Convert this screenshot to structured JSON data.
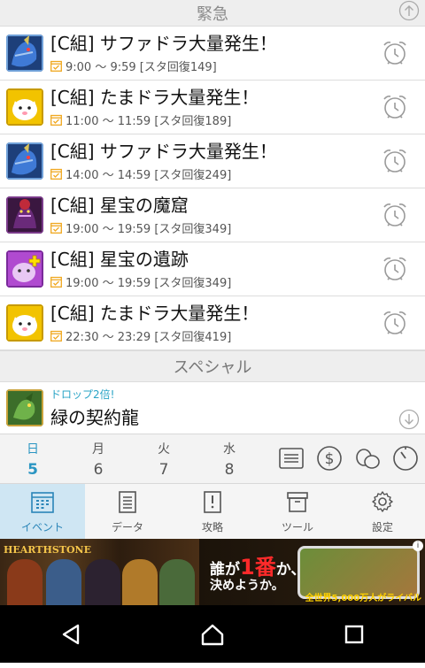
{
  "urgent_header": "緊急",
  "events": [
    {
      "title": "[C組] サファドラ大量発生！",
      "time": "9:00 ～ 9:59 [スタ回復149]",
      "monster": "blue-dragon"
    },
    {
      "title": "[C組] たまドラ大量発生！",
      "time": "11:00 ～ 11:59 [スタ回復189]",
      "monster": "tamadra"
    },
    {
      "title": "[C組] サファドラ大量発生！",
      "time": "14:00 ～ 14:59 [スタ回復249]",
      "monster": "blue-dragon"
    },
    {
      "title": "[C組] 星宝の魔窟",
      "time": "19:00 ～ 19:59 [スタ回復349]",
      "monster": "dark-demon"
    },
    {
      "title": "[C組] 星宝の遺跡",
      "time": "19:00 ～ 19:59 [スタ回復349]",
      "monster": "purple-plus"
    },
    {
      "title": "[C組] たまドラ大量発生！",
      "time": "22:30 ～ 23:29 [スタ回復419]",
      "monster": "tamadra"
    }
  ],
  "special_header": "スペシャル",
  "special": {
    "drop_label": "ドロップ2倍!",
    "title": "緑の契約龍"
  },
  "days": [
    {
      "dow": "日",
      "num": "5",
      "selected": true
    },
    {
      "dow": "月",
      "num": "6",
      "selected": false
    },
    {
      "dow": "火",
      "num": "7",
      "selected": false
    },
    {
      "dow": "水",
      "num": "8",
      "selected": false
    }
  ],
  "nav": [
    {
      "label": "イベント",
      "icon": "calendar-icon",
      "active": true
    },
    {
      "label": "データ",
      "icon": "list-icon",
      "active": false
    },
    {
      "label": "攻略",
      "icon": "book-icon",
      "active": false
    },
    {
      "label": "ツール",
      "icon": "box-icon",
      "active": false
    },
    {
      "label": "設定",
      "icon": "gear-icon",
      "active": false
    }
  ],
  "ad": {
    "brand": "HEARTHSTONE",
    "line1_a": "誰が",
    "line1_big": "1番",
    "line1_b": "か、",
    "line2": "決めようか。",
    "footer": "全世界5,000万人がライバル"
  },
  "colors": {
    "accent": "#2a95c2",
    "active_tab_bg": "#cfe6f3",
    "calendar_icon": "#f0a820"
  }
}
